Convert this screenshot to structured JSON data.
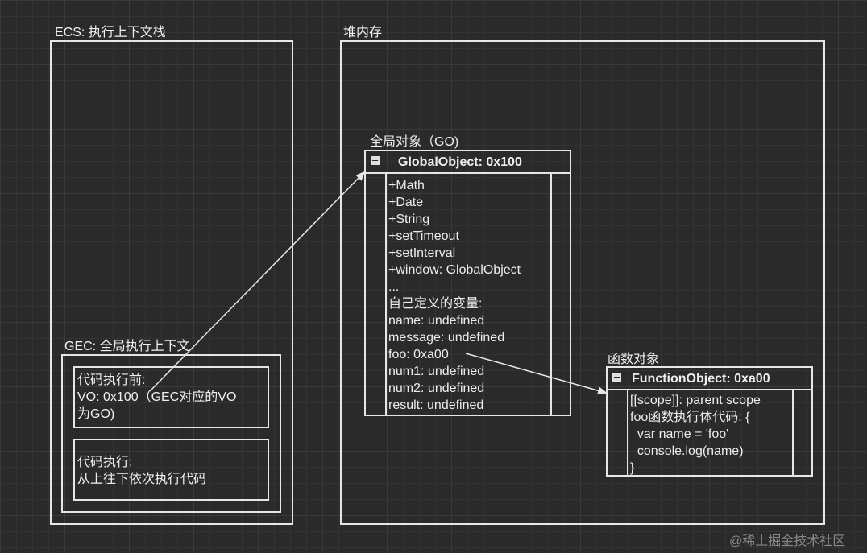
{
  "ecs": {
    "title": "ECS: 执行上下文栈"
  },
  "heap": {
    "title": "堆内存"
  },
  "gec": {
    "title": "GEC: 全局执行上下文",
    "before": {
      "line1": "代码执行前:",
      "line2": "VO: 0x100（GEC对应的VO",
      "line3": "为GO)"
    },
    "exec": {
      "line1": "代码执行:",
      "line2": "从上往下依次执行代码"
    }
  },
  "go": {
    "caption": "全局对象（GO)",
    "header": "GlobalObject: 0x100",
    "rows": [
      "+Math",
      "+Date",
      "+String",
      "+setTimeout",
      "+setInterval",
      "+window: GlobalObject",
      "...",
      "自己定义的变量:",
      "name: undefined",
      "message: undefined",
      "foo: 0xa00",
      "num1: undefined",
      "num2: undefined",
      "result: undefined"
    ]
  },
  "fo": {
    "caption": "函数对象",
    "header": "FunctionObject: 0xa00",
    "rows": [
      "[[scope]]: parent scope",
      "foo函数执行体代码: {",
      "  var name = 'foo'",
      "  console.log(name)",
      "}"
    ]
  },
  "watermark": "@稀土掘金技术社区",
  "colors": {
    "background": "#2a2a2a",
    "stroke": "#e6e6e6",
    "text": "#f0f0f0"
  }
}
